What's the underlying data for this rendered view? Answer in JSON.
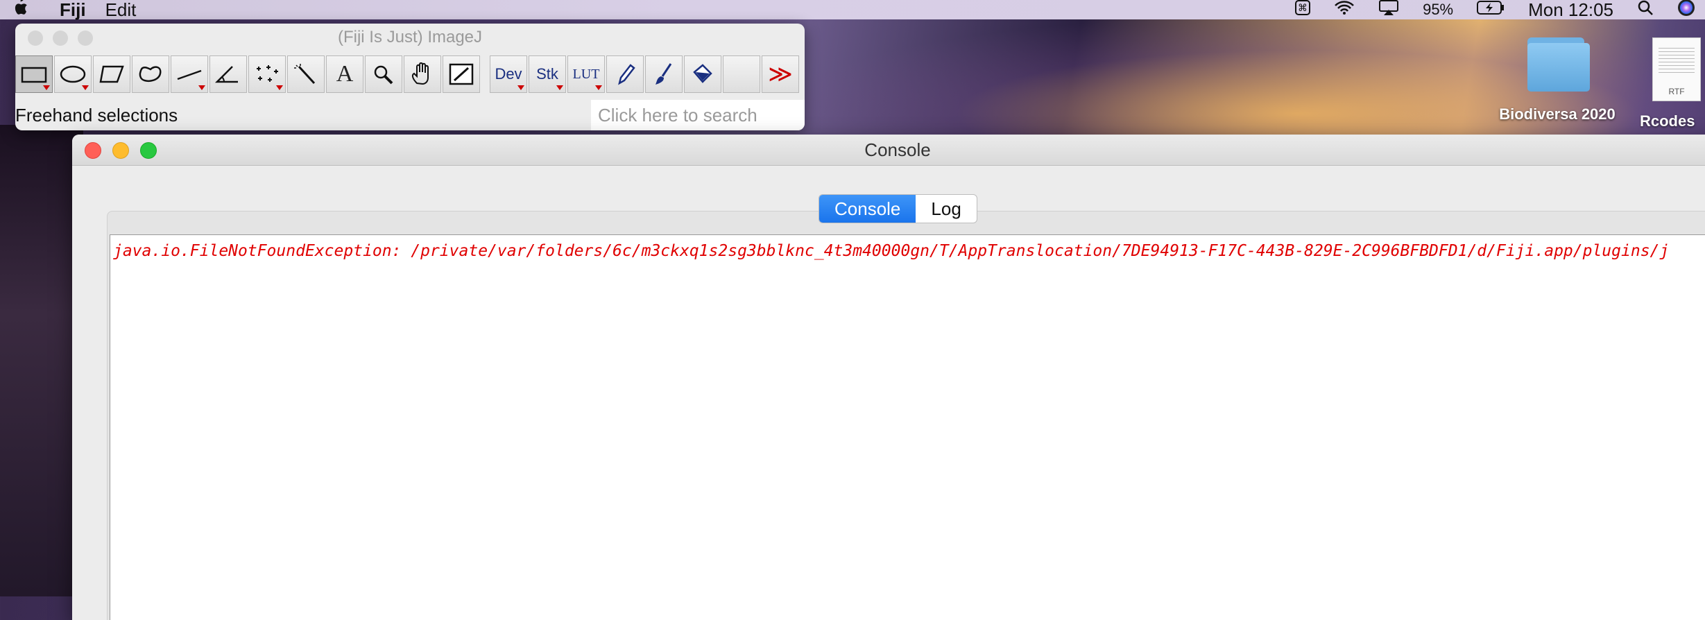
{
  "menubar": {
    "app_name": "Fiji",
    "items": [
      "Edit"
    ],
    "status": {
      "battery": "95%",
      "clock": "Mon 12:05"
    },
    "icons": [
      "apple-icon",
      "command-icon",
      "wifi-icon",
      "airplay-icon",
      "battery-charging-icon",
      "spotlight-search-icon",
      "siri-icon"
    ]
  },
  "imagej": {
    "title": "(Fiji Is Just) ImageJ",
    "status_text": "Freehand selections",
    "search_placeholder": "Click here to search",
    "tools": [
      {
        "name": "rectangle",
        "selected": true
      },
      {
        "name": "oval"
      },
      {
        "name": "polygon"
      },
      {
        "name": "freehand"
      },
      {
        "name": "line"
      },
      {
        "name": "angle"
      },
      {
        "name": "multipoint"
      },
      {
        "name": "wand"
      },
      {
        "name": "text",
        "label": "A"
      },
      {
        "name": "magnifier"
      },
      {
        "name": "hand"
      },
      {
        "name": "color-picker"
      },
      {
        "name": "dev",
        "label": "Dev"
      },
      {
        "name": "stk",
        "label": "Stk"
      },
      {
        "name": "lut",
        "label": "LUT"
      },
      {
        "name": "pencil"
      },
      {
        "name": "brush"
      },
      {
        "name": "flood-fill"
      },
      {
        "name": "empty"
      },
      {
        "name": "more",
        "label": "≫"
      }
    ]
  },
  "desktop": {
    "icons": [
      {
        "label": "Biodiversa 2020",
        "type": "folder"
      },
      {
        "label": "Rcodes",
        "type": "RTF"
      }
    ]
  },
  "console": {
    "title": "Console",
    "tabs": [
      "Console",
      "Log"
    ],
    "active_tab": "Console",
    "lines": [
      "java.io.FileNotFoundException: /private/var/folders/6c/m3ckxq1s2sg3bblknc_4t3m40000gn/T/AppTranslocation/7DE94913-F17C-443B-829E-2C996BFBDFD1/d/Fiji.app/plugins/j"
    ]
  },
  "colors": {
    "error_text": "#e00000",
    "tab_active": "#1a74ec"
  }
}
